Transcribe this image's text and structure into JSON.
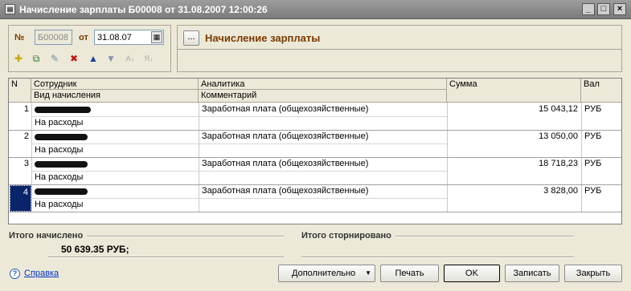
{
  "window": {
    "title": "Начисление зарплаты Б00008 от 31.08.2007 12:00:26",
    "icon": "document-icon"
  },
  "header": {
    "number_label": "№",
    "number_value": "Б00008",
    "date_label": "от",
    "date_value": "31.08.07",
    "select_button": "...",
    "operation_title": "Начисление зарплаты"
  },
  "toolbar": {
    "icons": [
      "add-row-icon",
      "copy-row-icon",
      "edit-row-icon",
      "delete-row-icon",
      "move-up-icon",
      "move-down-icon",
      "sort-asc-icon",
      "sort-desc-icon"
    ]
  },
  "table": {
    "headers": {
      "n": "N",
      "employee": "Сотрудник",
      "accrual_type": "Вид начисления",
      "analytics": "Аналитика",
      "comment": "Комментарий",
      "sum": "Сумма",
      "currency": "Вал"
    },
    "rows": [
      {
        "n": "1",
        "accrual": "На расходы",
        "analytics": "Заработная плата (общехозяйственные)",
        "sum": "15 043,12",
        "currency": "РУБ"
      },
      {
        "n": "2",
        "accrual": "На расходы",
        "analytics": "Заработная плата (общехозяйственные)",
        "sum": "13 050,00",
        "currency": "РУБ"
      },
      {
        "n": "3",
        "accrual": "На расходы",
        "analytics": "Заработная плата (общехозяйственные)",
        "sum": "18 718,23",
        "currency": "РУБ"
      },
      {
        "n": "4",
        "accrual": "На расходы",
        "analytics": "Заработная плата (общехозяйственные)",
        "sum": "3 828,00",
        "currency": "РУБ"
      }
    ]
  },
  "totals": {
    "accrued_label": "Итого начислено",
    "accrued_value": "50 639.35 РУБ;",
    "reversed_label": "Итого сторнировано"
  },
  "footer": {
    "help": "Справка",
    "more": "Дополнительно",
    "print": "Печать",
    "ok": "OK",
    "save": "Записать",
    "close": "Закрыть"
  },
  "colors": {
    "selection": "#0a246a",
    "label": "#7a3b00"
  }
}
